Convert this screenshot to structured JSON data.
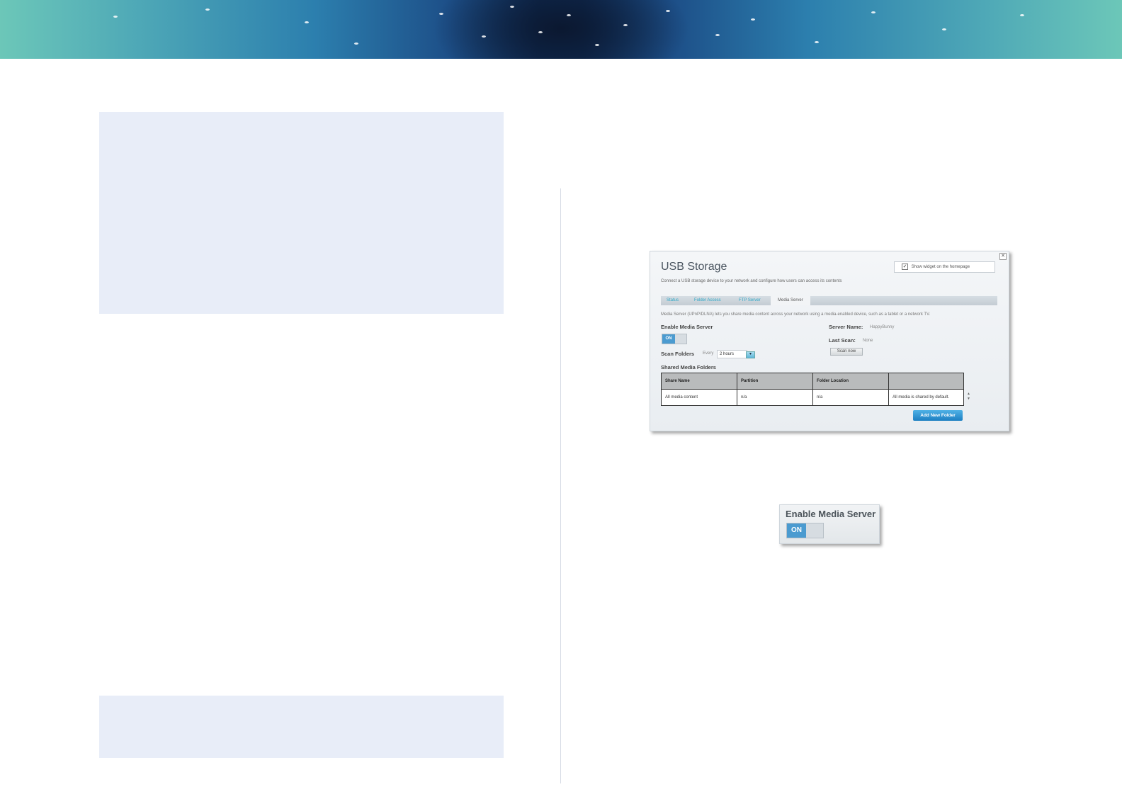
{
  "screenshot": {
    "title": "USB Storage",
    "subtitle": "Connect a USB storage device to your network and configure how users can access its contents",
    "widget_label": "Show widget on the homepage",
    "widget_checked": true,
    "close_glyph": "✕",
    "tabs": [
      "Status",
      "Folder Access",
      "FTP Server",
      "Media Server"
    ],
    "active_tab": "Media Server",
    "description": "Media Server (UPnP/DLNA) lets you share media content across your network using a media-enabled device, such as a tablet or a network TV.",
    "enable_label": "Enable Media Server",
    "toggle_state": "ON",
    "scan_folders_label": "Scan Folders",
    "scan_every": "Every",
    "scan_interval": "2 hours",
    "server_name_label": "Server Name:",
    "server_name_value": "HappyBunny",
    "last_scan_label": "Last Scan:",
    "last_scan_value": "None",
    "scan_now_label": "Scan now",
    "shared_title": "Shared Media Folders",
    "table_headers": [
      "Share Name",
      "Partition",
      "Folder Location",
      ""
    ],
    "table_rows": [
      [
        "All media content",
        "n/a",
        "n/a",
        "All media is shared by default."
      ]
    ],
    "add_folder_label": "Add New Folder"
  },
  "zoom": {
    "label": "Enable Media Server",
    "toggle_state": "ON"
  },
  "colors": {
    "note_box": "#e8edf8",
    "tab_link": "#2aa6c6",
    "toggle_on": "#4b9bd0",
    "add_button": "#1d7fc2"
  }
}
